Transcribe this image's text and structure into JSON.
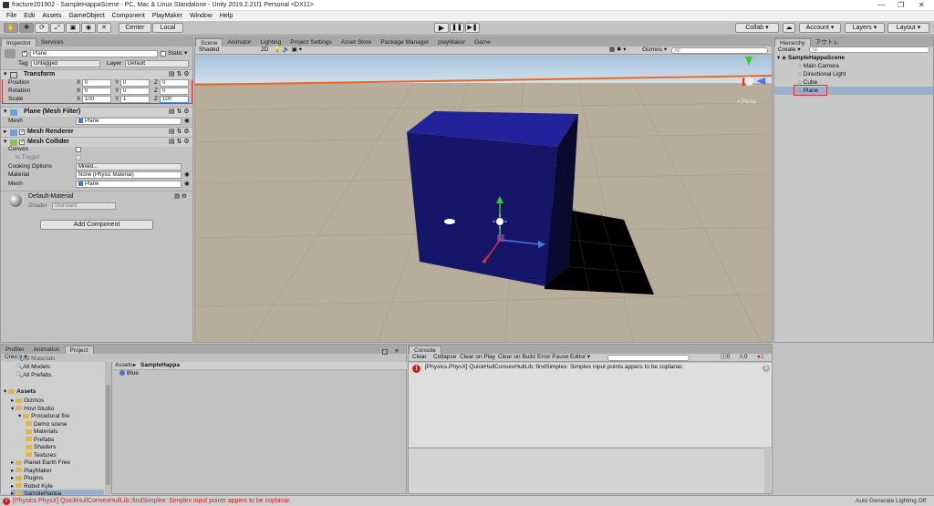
{
  "window": {
    "title": "fracture201902 - SampleHappaScene - PC, Mac & Linux Standalone - Unity 2019.2.21f1 Personal <DX11>"
  },
  "menu": [
    "File",
    "Edit",
    "Assets",
    "GameObject",
    "Component",
    "PlayMaker",
    "Window",
    "Help"
  ],
  "toolbar": {
    "pivot_label": "Center",
    "space_label": "Local",
    "collab_label": "Collab ▾",
    "account_label": "Account ▾",
    "layers_label": "Layers ▾",
    "layout_label": "Layout ▾"
  },
  "inspector": {
    "tabs": [
      "Inspector",
      "Services"
    ],
    "object_name": "Plane",
    "static_label": "Static ▾",
    "tag_label": "Tag",
    "tag_value": "Untagged",
    "layer_label": "Layer",
    "layer_value": "Default",
    "transform": {
      "title": "Transform",
      "rows": [
        {
          "label": "Position",
          "x": "0",
          "y": "0",
          "z": "0"
        },
        {
          "label": "Rotation",
          "x": "0",
          "y": "0",
          "z": "0"
        },
        {
          "label": "Scale",
          "x": "100",
          "y": "1",
          "z": "100"
        }
      ]
    },
    "mesh_filter": {
      "title": "Plane (Mesh Filter)",
      "mesh_label": "Mesh",
      "mesh_value": "Plane"
    },
    "mesh_renderer": {
      "title": "Mesh Renderer"
    },
    "mesh_collider": {
      "title": "Mesh Collider",
      "convex_label": "Convex",
      "trigger_label": "Is Trigger",
      "cooking_label": "Cooking Options",
      "cooking_value": "Mixed...",
      "material_label": "Material",
      "material_value": "None (Physic Material)",
      "mesh_label": "Mesh",
      "mesh_value": "Plane"
    },
    "material": {
      "name": "Default-Material",
      "shader_label": "Shader",
      "shader_value": "Standard"
    },
    "add_component": "Add Component"
  },
  "scene": {
    "tabs": [
      "Scene",
      "Animator",
      "Lighting",
      "Project Settings",
      "Asset Store",
      "Package Manager",
      "playMaker",
      "Game"
    ],
    "shading": "Shaded",
    "mode_2d": "2D",
    "gizmos": "Gizmos ▾",
    "search_placeholder": "All",
    "persp_label": "< Persp"
  },
  "hierarchy": {
    "tab": "Hierarchy",
    "tab2": "アウトレ",
    "create": "Create ▾",
    "search_placeholder": "All",
    "scene": "SampleHappaScene",
    "items": [
      "Main Camera",
      "Directional Light",
      "Cube",
      "Plane"
    ]
  },
  "project": {
    "tabs": [
      "Profiler",
      "Animation",
      "Project"
    ],
    "create": "Create ▾",
    "tree_top": [
      "All Materials",
      "All Models",
      "All Prefabs"
    ],
    "assets_label": "Assets",
    "tree": [
      {
        "name": "Gizmos",
        "indent": 1
      },
      {
        "name": "Hovl Studio",
        "indent": 1
      },
      {
        "name": "Procedural fire",
        "indent": 2
      },
      {
        "name": "Demo scene",
        "indent": 3
      },
      {
        "name": "Materials",
        "indent": 3
      },
      {
        "name": "Prefabs",
        "indent": 3
      },
      {
        "name": "Shaders",
        "indent": 3
      },
      {
        "name": "Textures",
        "indent": 3
      },
      {
        "name": "Planet Earth Free",
        "indent": 1
      },
      {
        "name": "PlayMaker",
        "indent": 1
      },
      {
        "name": "Plugins",
        "indent": 1
      },
      {
        "name": "Robot Kyle",
        "indent": 1
      },
      {
        "name": "SampleHappa",
        "indent": 1
      }
    ],
    "breadcrumb_root": "Assets",
    "breadcrumb_folder": "SampleHappa",
    "files": [
      "Blue"
    ]
  },
  "console": {
    "tab": "Console",
    "buttons": [
      "Clear",
      "Collapse",
      "Clear on Play",
      "Clear on Build",
      "Error Pause",
      "Editor ▾"
    ],
    "counts": {
      "info": "0",
      "warn": "0",
      "error": "1"
    },
    "message": "[Physics.PhysX] QuickHullConvexHullLib::findSimplex: Simplex input points appers to be coplanar.",
    "message_count": "9"
  },
  "statusbar": {
    "message": "[Physics.PhysX] QuickHullConvexHullLib::findSimplex: Simplex input points appers to be coplanar.",
    "right": "Auto Generate Lighting Off"
  },
  "colors": {
    "error": "#cc2222",
    "highlight": "#e03030",
    "selection": "#4a8de8",
    "cube": "#1a1a7a"
  }
}
